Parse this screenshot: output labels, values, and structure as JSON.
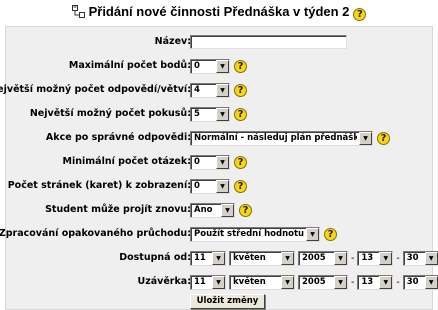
{
  "heading": {
    "title": "Přidání nové činnosti Přednáška v týden 2",
    "icon": "lesson-module-icon"
  },
  "form": {
    "name": {
      "label": "Název:",
      "value": ""
    },
    "max_points": {
      "label": "Maximální počet bodů:",
      "value": "0"
    },
    "max_answers": {
      "label": "Největší možný počet odpovědí/větví:",
      "value": "4"
    },
    "max_attempts": {
      "label": "Největší možný počet pokusů:",
      "value": "5"
    },
    "action_after_correct": {
      "label": "Akce po správné odpovědi:",
      "value": "Normální - následuj plán přednášky"
    },
    "min_questions": {
      "label": "Minimální počet otázek:",
      "value": "0"
    },
    "num_pages": {
      "label": "Počet stránek (karet) k zobrazení:",
      "value": "0"
    },
    "student_can_retake": {
      "label": "Student může projít znovu:",
      "value": "Ano"
    },
    "handling_retakes": {
      "label": "Zpracování opakovaného průchodu:",
      "value": "Použít střední hodnotu"
    },
    "available_from": {
      "label": "Dostupná od:",
      "day": "11",
      "month": "květen",
      "year": "2005",
      "hour": "13",
      "minute": "30"
    },
    "deadline": {
      "label": "Uzávěrka:",
      "day": "11",
      "month": "květen",
      "year": "2005",
      "hour": "13",
      "minute": "30"
    },
    "date_separator": "-",
    "save_button": "Uložit změny"
  },
  "help_glyph": "?",
  "select_arrow_glyph": "▼",
  "colors": {
    "panel": "#efefef",
    "help": "#f7d613"
  }
}
